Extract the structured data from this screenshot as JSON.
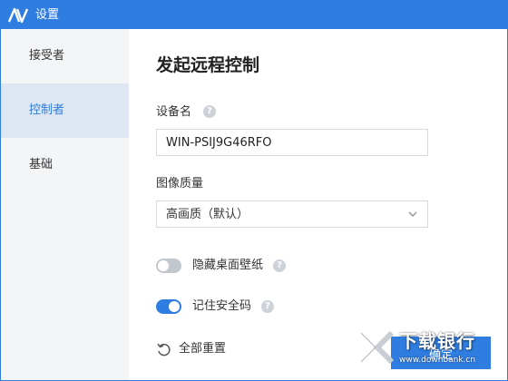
{
  "window": {
    "title": "设置"
  },
  "sidebar": {
    "items": [
      {
        "label": "接受者",
        "active": false
      },
      {
        "label": "控制者",
        "active": true
      },
      {
        "label": "基础",
        "active": false
      }
    ]
  },
  "main": {
    "title": "发起远程控制",
    "device_name": {
      "label": "设备名",
      "value": "WIN-PSIJ9G46RFO"
    },
    "image_quality": {
      "label": "图像质量",
      "selected": "高画质（默认）"
    },
    "hide_wallpaper": {
      "label": "隐藏桌面壁纸",
      "on": false
    },
    "remember_code": {
      "label": "记住安全码",
      "on": true
    },
    "reset_label": "全部重置",
    "confirm_label": "确定"
  },
  "watermark": {
    "text": "下载银行",
    "domain": "www.downbank.cn"
  },
  "colors": {
    "accent": "#2f7de1",
    "sidebar_bg": "#f4f5f7",
    "sidebar_active_bg": "#dde6f2",
    "toggle_off": "#c3c8cf"
  },
  "icons": [
    "app-logo-icon",
    "help-icon",
    "chevron-down-icon",
    "reset-icon",
    "watermark-logo-icon"
  ]
}
